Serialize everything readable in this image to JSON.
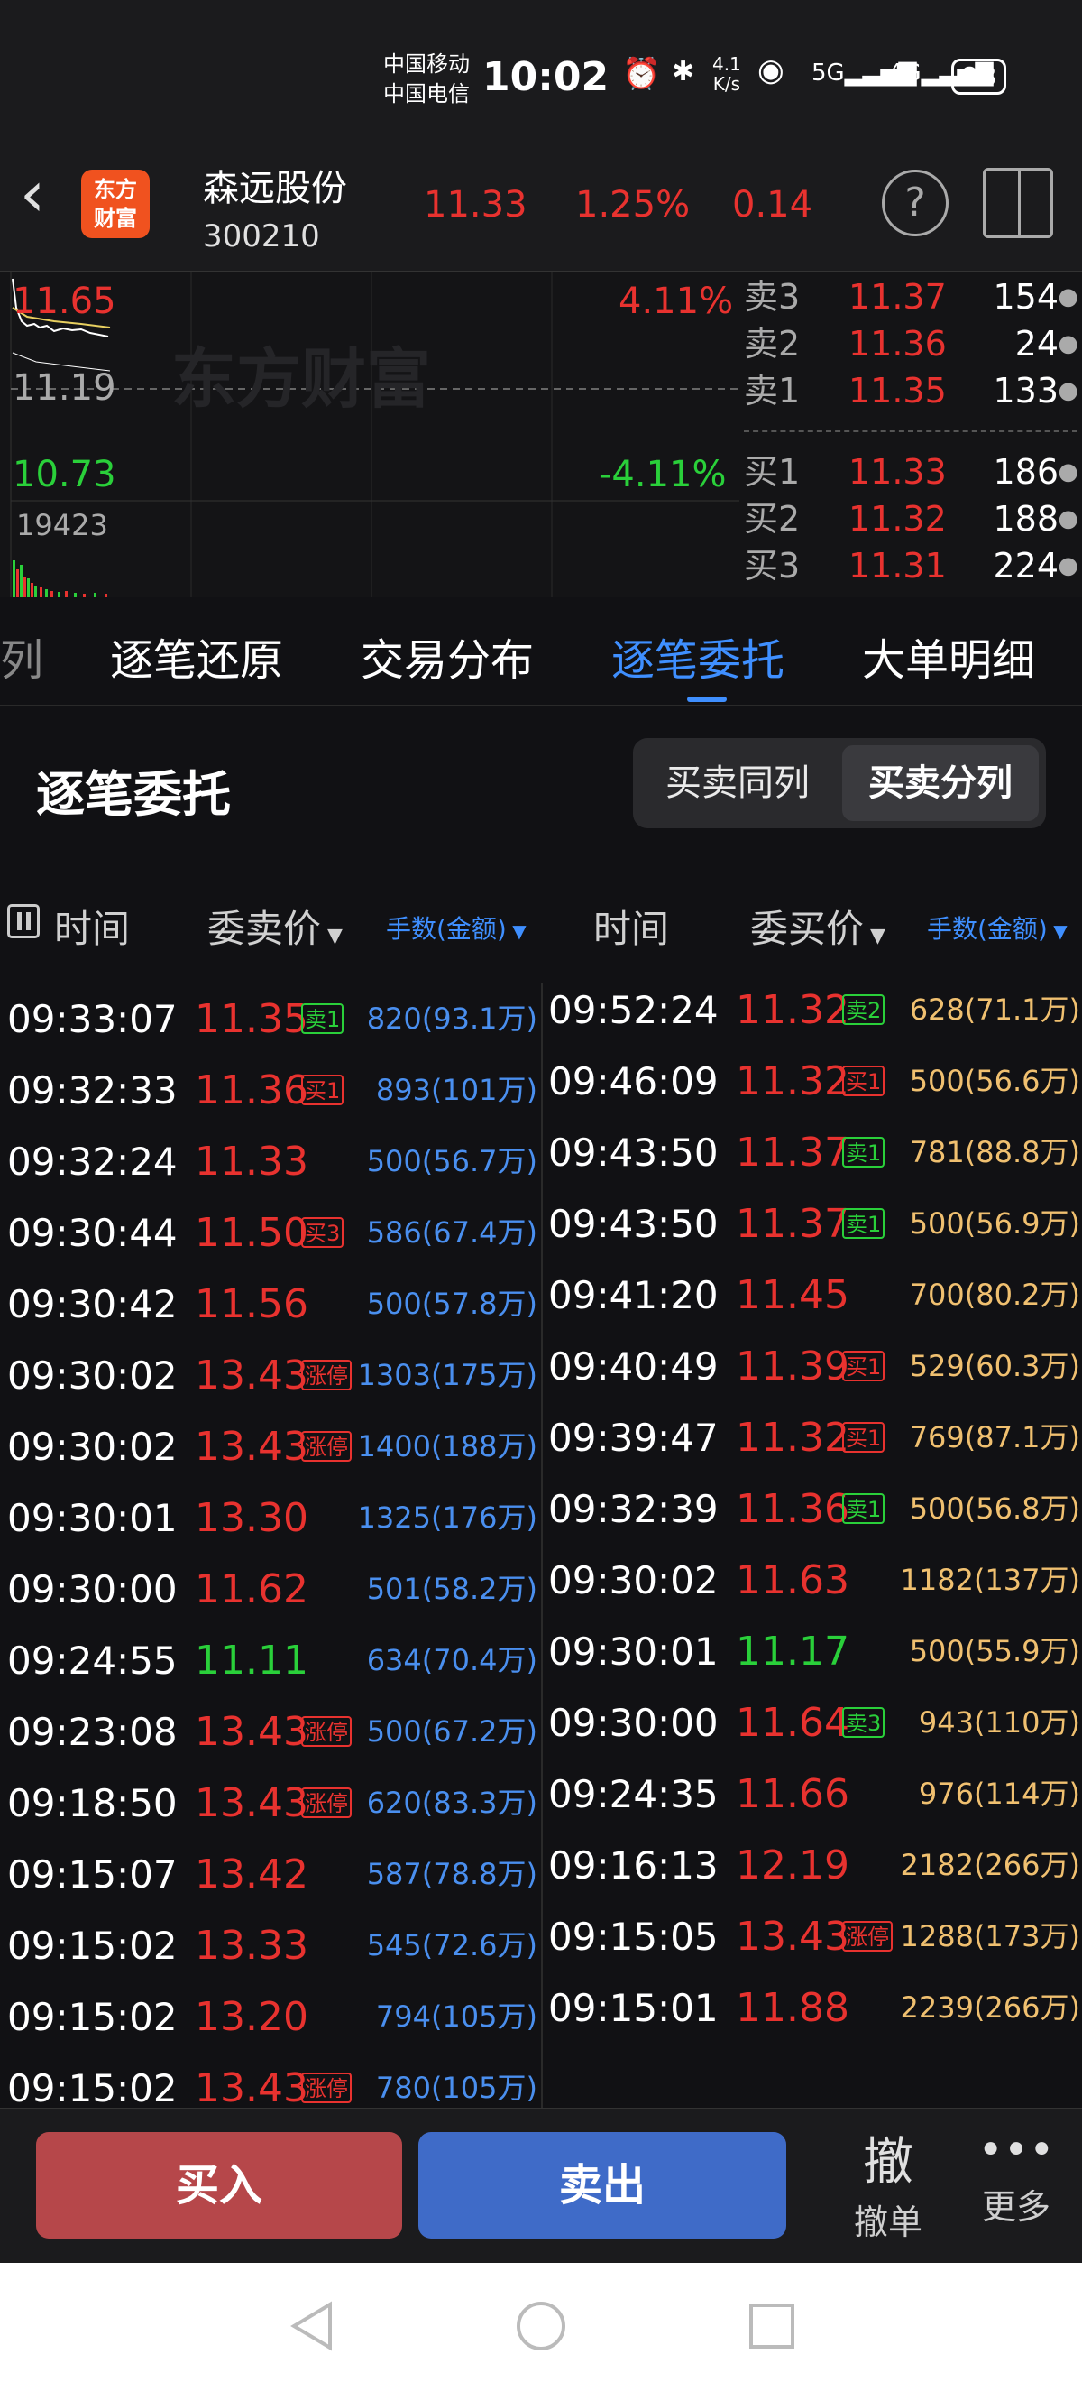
{
  "status_bar": {
    "carrier1": "中国移动",
    "carrier2": "中国电信",
    "time": "10:02",
    "speed_top": "4.1",
    "speed_bottom": "K/s",
    "battery": "98"
  },
  "header": {
    "logo_text1": "东方",
    "logo_text2": "财富",
    "stock_name": "森远股份",
    "stock_code": "300210",
    "price": "11.33",
    "change_pct": "1.25%",
    "change_amt": "0.14"
  },
  "quote": {
    "high_price": "11.65",
    "high_pct": "4.11%",
    "mid_price": "11.19",
    "low_price": "10.73",
    "low_pct": "-4.11%",
    "volume": "19423",
    "watermark": "东方财富",
    "order_book": {
      "asks": [
        {
          "label": "卖3",
          "price": "11.37",
          "qty": "154"
        },
        {
          "label": "卖2",
          "price": "11.36",
          "qty": "24"
        },
        {
          "label": "卖1",
          "price": "11.35",
          "qty": "133"
        }
      ],
      "bids": [
        {
          "label": "买1",
          "price": "11.33",
          "qty": "186"
        },
        {
          "label": "买2",
          "price": "11.32",
          "qty": "188"
        },
        {
          "label": "买3",
          "price": "11.31",
          "qty": "224"
        }
      ]
    }
  },
  "tabs": {
    "partial": "列",
    "t1": "逐笔还原",
    "t2": "交易分布",
    "t3": "逐笔委托",
    "t4": "大单明细"
  },
  "section": {
    "title": "逐笔委托",
    "toggle_same": "买卖同列",
    "toggle_split": "买卖分列"
  },
  "columns": {
    "left_time": "时间",
    "left_price": "委卖价",
    "left_vol": "手数(金额)",
    "right_time": "时间",
    "right_price": "委买价",
    "right_vol": "手数(金额)"
  },
  "sell_orders": [
    {
      "time": "09:33:07",
      "price": "11.35",
      "badge": "卖1",
      "vol": "820(93.1万)"
    },
    {
      "time": "09:32:33",
      "price": "11.36",
      "badge": "买1",
      "vol": "893(101万)"
    },
    {
      "time": "09:32:24",
      "price": "11.33",
      "badge": "",
      "vol": "500(56.7万)"
    },
    {
      "time": "09:30:44",
      "price": "11.50",
      "badge": "买3",
      "vol": "586(67.4万)"
    },
    {
      "time": "09:30:42",
      "price": "11.56",
      "badge": "",
      "vol": "500(57.8万)"
    },
    {
      "time": "09:30:02",
      "price": "13.43",
      "badge": "涨停",
      "vol": "1303(175万)"
    },
    {
      "time": "09:30:02",
      "price": "13.43",
      "badge": "涨停",
      "vol": "1400(188万)"
    },
    {
      "time": "09:30:01",
      "price": "13.30",
      "badge": "",
      "vol": "1325(176万)"
    },
    {
      "time": "09:30:00",
      "price": "11.62",
      "badge": "",
      "vol": "501(58.2万)"
    },
    {
      "time": "09:24:55",
      "price": "11.11",
      "badge": "",
      "vol": "634(70.4万)"
    },
    {
      "time": "09:23:08",
      "price": "13.43",
      "badge": "涨停",
      "vol": "500(67.2万)"
    },
    {
      "time": "09:18:50",
      "price": "13.43",
      "badge": "涨停",
      "vol": "620(83.3万)"
    },
    {
      "time": "09:15:07",
      "price": "13.42",
      "badge": "",
      "vol": "587(78.8万)"
    },
    {
      "time": "09:15:02",
      "price": "13.33",
      "badge": "",
      "vol": "545(72.6万)"
    },
    {
      "time": "09:15:02",
      "price": "13.20",
      "badge": "",
      "vol": "794(105万)"
    },
    {
      "time": "09:15:02",
      "price": "13.43",
      "badge": "涨停",
      "vol": "780(105万)"
    }
  ],
  "buy_orders": [
    {
      "time": "09:52:24",
      "price": "11.32",
      "badge": "卖2",
      "vol": "628(71.1万)"
    },
    {
      "time": "09:46:09",
      "price": "11.32",
      "badge": "买1",
      "vol": "500(56.6万)"
    },
    {
      "time": "09:43:50",
      "price": "11.37",
      "badge": "卖1",
      "vol": "781(88.8万)"
    },
    {
      "time": "09:43:50",
      "price": "11.37",
      "badge": "卖1",
      "vol": "500(56.9万)"
    },
    {
      "time": "09:41:20",
      "price": "11.45",
      "badge": "",
      "vol": "700(80.2万)"
    },
    {
      "time": "09:40:49",
      "price": "11.39",
      "badge": "买1",
      "vol": "529(60.3万)"
    },
    {
      "time": "09:39:47",
      "price": "11.32",
      "badge": "买1",
      "vol": "769(87.1万)"
    },
    {
      "time": "09:32:39",
      "price": "11.36",
      "badge": "卖1",
      "vol": "500(56.8万)"
    },
    {
      "time": "09:30:02",
      "price": "11.63",
      "badge": "",
      "vol": "1182(137万)"
    },
    {
      "time": "09:30:01",
      "price": "11.17",
      "badge": "",
      "vol": "500(55.9万)"
    },
    {
      "time": "09:30:00",
      "price": "11.64",
      "badge": "卖3",
      "vol": "943(110万)"
    },
    {
      "time": "09:24:35",
      "price": "11.66",
      "badge": "",
      "vol": "976(114万)"
    },
    {
      "time": "09:16:13",
      "price": "12.19",
      "badge": "",
      "vol": "2182(266万)"
    },
    {
      "time": "09:15:05",
      "price": "13.43",
      "badge": "涨停",
      "vol": "1288(173万)"
    },
    {
      "time": "09:15:01",
      "price": "11.88",
      "badge": "",
      "vol": "2239(266万)"
    }
  ],
  "bottom": {
    "buy": "买入",
    "sell": "卖出",
    "cancel_icon": "撤",
    "cancel": "撤单",
    "more": "更多"
  },
  "colors": {
    "up": "#e8322f",
    "down": "#2ad03a",
    "accent": "#3f8fff"
  }
}
